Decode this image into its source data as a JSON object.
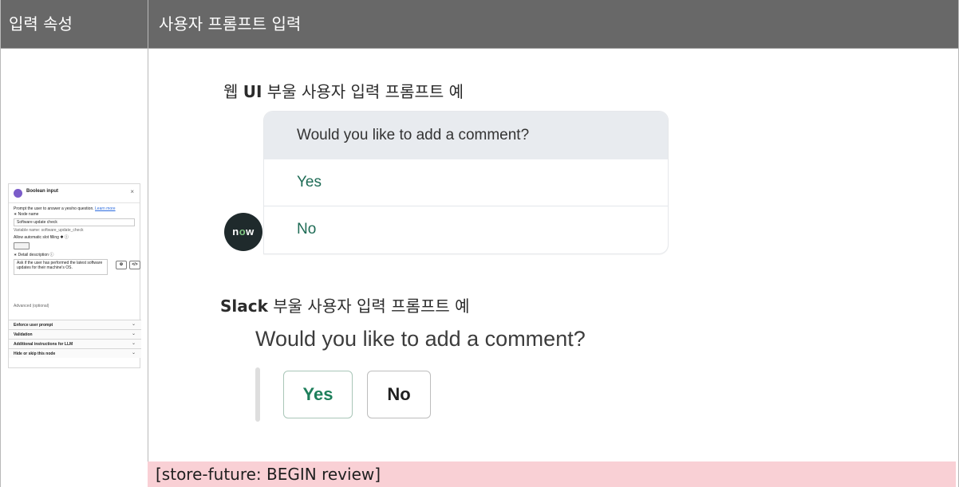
{
  "header": {
    "col1": "입력 속성",
    "col2": "사용자 프롬프트 입력"
  },
  "panel": {
    "title": "Boolean input",
    "close": "×",
    "intro": "Prompt the user to answer a yes/no question.",
    "learn_more": "Learn more",
    "node_name_label": "∗ Node name",
    "node_name_value": "Software update check",
    "variable_name": "Variable name: software_update_check",
    "slot_filling_label": "Allow automatic slot filling ✱ ⓘ",
    "detail_label": "∗ Detail description ⓘ",
    "detail_value": "Ask if the user has performed the latest software updates for their machine's OS.",
    "btn1": "⚙",
    "btn2": "</>",
    "advanced": "Advanced (optional)",
    "sections": [
      "Enforce user prompt",
      "Validation",
      "Additional instructions for LLM",
      "Hide or skip this node"
    ],
    "chevron": "⌄"
  },
  "web": {
    "heading_pre": "웹 ",
    "heading_bold": "UI",
    "heading_post": " 부울 사용자 입력 프롬프트 예",
    "question": "Would you like to add a comment?",
    "yes": "Yes",
    "no": "No",
    "logo_n": "n",
    "logo_o": "o",
    "logo_w": "w"
  },
  "slack": {
    "heading_bold": "Slack",
    "heading_post": " 부울 사용자 입력 프롬프트 예",
    "question": "Would you like to add a comment?",
    "yes": "Yes",
    "no": "No"
  },
  "review_banner": "[store-future: BEGIN review]",
  "colors": {
    "header_bg": "#686868",
    "option_green": "#1f6c56",
    "review_bg": "#f9d0d5",
    "node_icon": "#7b5cc9"
  }
}
